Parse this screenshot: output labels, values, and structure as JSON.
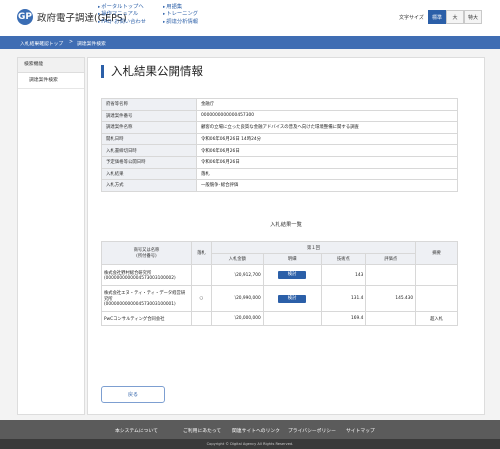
{
  "header": {
    "logo_mark": "GP",
    "logo_text": "政府電子調達(GEPS)",
    "links_col1": [
      "ポータルトップへ",
      "操作マニュアル",
      "FAQ･お問い合わせ"
    ],
    "links_col2": [
      "用語集",
      "トレーニング",
      "調達分析情報"
    ],
    "font_size_label": "文字サイズ",
    "font_sizes": [
      "標準",
      "大",
      "特大"
    ]
  },
  "breadcrumb": [
    "入札結果確認トップ",
    ">",
    "調達案件検索"
  ],
  "sidebar": {
    "heading": "検索機能",
    "items": [
      "調達案件検索"
    ]
  },
  "page": {
    "title": "入札結果公開情報"
  },
  "info": [
    {
      "label": "府省等名称",
      "value": "金融庁"
    },
    {
      "label": "調達案件番号",
      "value": "0000000000000457300"
    },
    {
      "label": "調達案件名称",
      "value": "顧客の立場に立った良質な金融アドバイスの普及へ向けた環境整備に関する調査"
    },
    {
      "label": "開札日時",
      "value": "令和06年06月26日 14時24分"
    },
    {
      "label": "入札書締切日時",
      "value": "令和06年06月26日"
    },
    {
      "label": "予定価格等公開日時",
      "value": "令和06年06月26日"
    },
    {
      "label": "入札結果",
      "value": "落札"
    },
    {
      "label": "入札方式",
      "value": "一般競争･総合評価"
    }
  ],
  "results": {
    "title": "入札結果一覧",
    "headers": {
      "company": "商号又は名称",
      "company_sub": "(所付番号)",
      "winner": "落札",
      "round": "第１回",
      "amount": "入札金額",
      "detail": "明細",
      "tech": "技術点",
      "score": "評価点",
      "note": "摘要"
    },
    "rows": [
      {
        "company": "株式会社野村総合研究所",
        "code": "(0000000000004573003100002)",
        "winner": "",
        "amount": "\\20,912,700",
        "detail": "検討",
        "tech": "143",
        "score": "",
        "note": ""
      },
      {
        "company": "株式会社エヌ・ティ・ティ・データ経営研究所",
        "code": "(0000000000004573003100001)",
        "winner": "○",
        "amount": "\\20,990,000",
        "detail": "検討",
        "tech": "131.4",
        "score": "145.430",
        "note": ""
      },
      {
        "company": "PwCコンサルティング合同会社",
        "code": "",
        "winner": "",
        "amount": "\\20,000,000",
        "detail": "",
        "tech": "169.4",
        "score": "",
        "note": "超入札"
      }
    ]
  },
  "back_label": "戻る",
  "footer": {
    "links": [
      "本システムについて",
      "ご利用にあたって",
      "関連サイトへのリンク",
      "プライバシーポリシー",
      "サイトマップ"
    ],
    "copyright": "Copyright © Digital Agency All Rights Reserved."
  }
}
